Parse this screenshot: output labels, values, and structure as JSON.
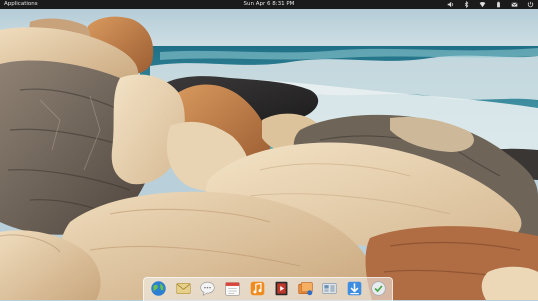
{
  "panel": {
    "apps_label": "Applications",
    "clock": "Sun Apr 6  8:31 PM",
    "indicators": [
      "volume-icon",
      "bluetooth-icon",
      "wifi-icon",
      "battery-icon",
      "mail-icon",
      "power-icon"
    ]
  },
  "dock": {
    "items": [
      "browser-icon",
      "mail-app-icon",
      "chat-icon",
      "calendar-icon",
      "music-icon",
      "video-icon",
      "photos-icon",
      "settings-icon",
      "software-center-icon",
      "updates-icon"
    ]
  },
  "colors": {
    "panel_bg": "#1b1b1b",
    "panel_text": "#e8e8e8",
    "sky": "#b9cfd9",
    "sea": "#2f8a9c",
    "foam": "#e6eef0",
    "rock_light": "#e2c9a2",
    "rock_dark": "#4a4440"
  }
}
